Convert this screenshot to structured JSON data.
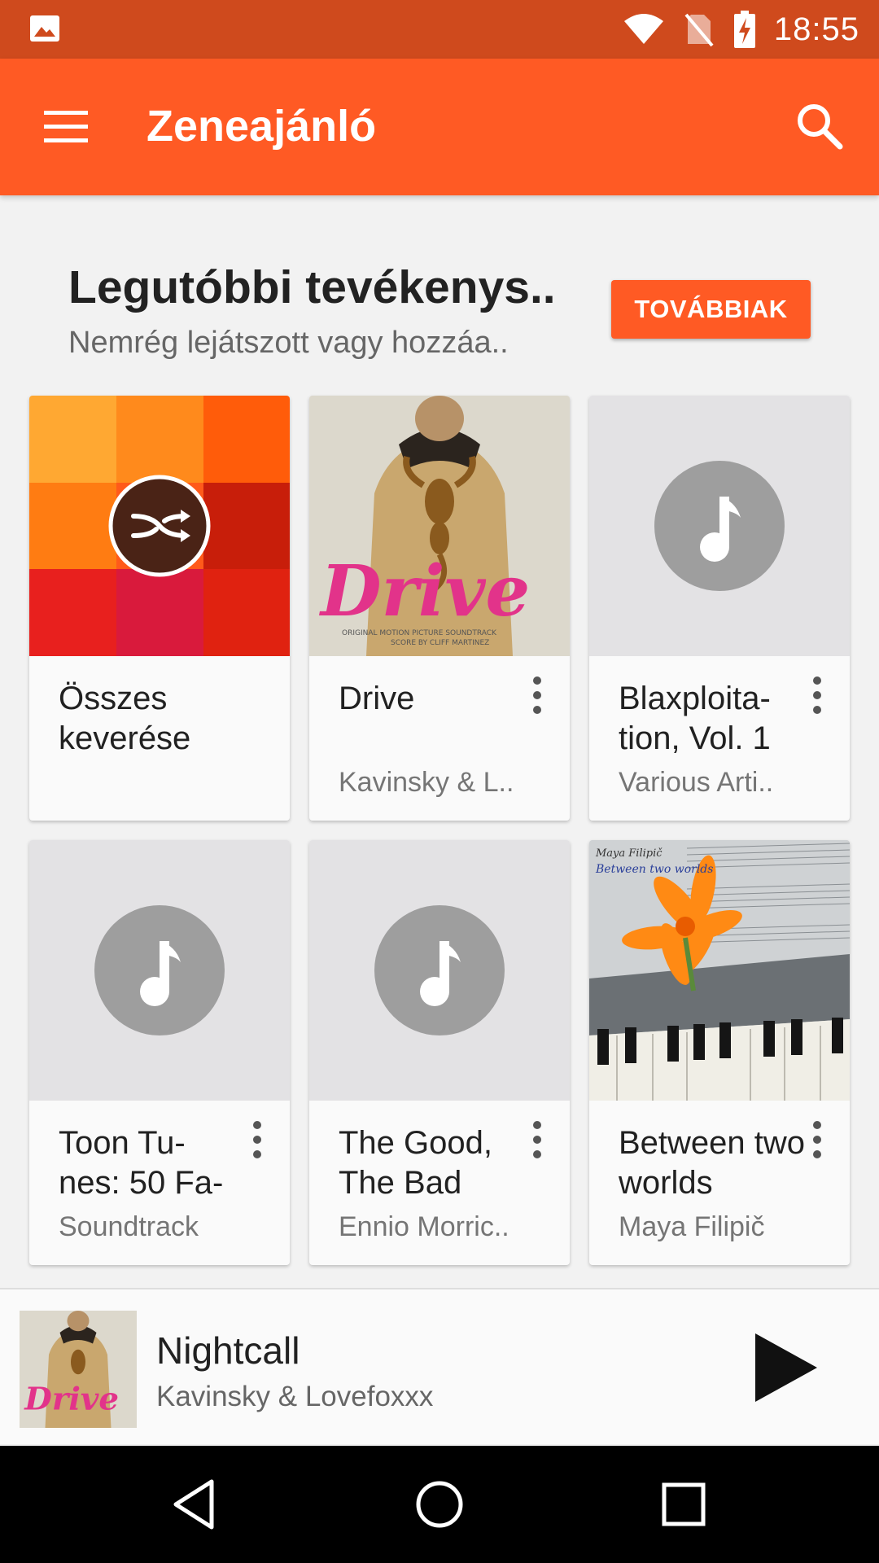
{
  "status_bar": {
    "time": "18:55",
    "left_icon": "image-notification-icon",
    "icons": [
      "wifi-icon",
      "no-sim-icon",
      "battery-charging-icon"
    ]
  },
  "app_bar": {
    "title": "Zeneajánló",
    "menu_icon": "hamburger-menu-icon",
    "search_icon": "search-icon",
    "color": "#ff5a24"
  },
  "section": {
    "title": "Legutóbbi tevékenys..",
    "subtitle": "Nemrég lejátszott vagy hozzáa..",
    "more_button": "TOVÁBBIAK"
  },
  "cards": [
    {
      "title": "Összes keverése",
      "subtitle": "",
      "art": "shuffle-mosaic"
    },
    {
      "title": "Drive",
      "subtitle": "Kavinsky & L..",
      "art": "drive-cover"
    },
    {
      "title": "Blaxploita-tion, Vol. 1",
      "subtitle": "Various Arti..",
      "art": "placeholder"
    },
    {
      "title": "Toon Tu-nes: 50 Fa-",
      "subtitle": "Soundtrack",
      "art": "placeholder"
    },
    {
      "title": "The Good, The Bad",
      "subtitle": "Ennio Morric..",
      "art": "placeholder"
    },
    {
      "title": "Between two worlds",
      "subtitle": "Maya Filipič",
      "art": "between-two-worlds-cover"
    }
  ],
  "cover_text": {
    "drive_logo": "Drive",
    "drive_credit_1": "ORIGINAL MOTION PICTURE SOUNDTRACK",
    "drive_credit_2": "SCORE BY CLIFF MARTINEZ",
    "btw_artist": "Maya Filipič",
    "btw_title": "Between two worlds"
  },
  "player": {
    "song": "Nightcall",
    "artist": "Kavinsky & Lovefoxxx",
    "play_icon": "play-icon"
  },
  "nav_bar": [
    "back-icon",
    "home-icon",
    "recents-icon"
  ]
}
